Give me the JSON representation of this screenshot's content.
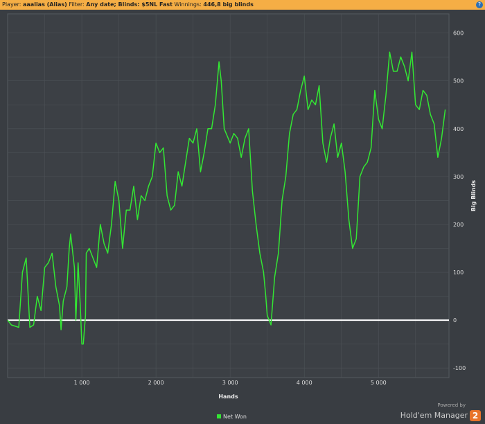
{
  "header": {
    "player_label": "Player:",
    "player": "aaalias (Alias)",
    "filter_label": "Filter:",
    "filter": "Any date; Blinds: $5NL Fast",
    "winnings_label": "Winnings:",
    "winnings": "446,8 big blinds",
    "help": "?"
  },
  "logo": {
    "powered": "Powered by",
    "name": "Hold'em Manager",
    "badge": "2"
  },
  "chart_data": {
    "type": "line",
    "title": "",
    "xlabel": "Hands",
    "ylabel": "Big Blinds",
    "xlim": [
      0,
      5950
    ],
    "ylim": [
      -120,
      640
    ],
    "xticks": [
      1000,
      2000,
      3000,
      4000,
      5000
    ],
    "xtick_labels": [
      "1 000",
      "2 000",
      "3 000",
      "4 000",
      "5 000"
    ],
    "yticks": [
      -100,
      0,
      100,
      200,
      300,
      400,
      500,
      600
    ],
    "ytick_labels": [
      "-100",
      "0",
      "100",
      "200",
      "300",
      "400",
      "500",
      "600"
    ],
    "grid": true,
    "legend": "bottom-center",
    "line_color": "#33e633",
    "series": [
      {
        "name": "Net Won",
        "x": [
          0,
          50,
          150,
          200,
          250,
          300,
          350,
          400,
          450,
          500,
          550,
          600,
          650,
          700,
          720,
          750,
          800,
          830,
          850,
          900,
          920,
          950,
          980,
          1000,
          1020,
          1050,
          1060,
          1100,
          1200,
          1250,
          1300,
          1350,
          1400,
          1450,
          1500,
          1550,
          1600,
          1650,
          1700,
          1750,
          1800,
          1850,
          1900,
          1950,
          2000,
          2050,
          2100,
          2150,
          2200,
          2250,
          2300,
          2350,
          2400,
          2450,
          2500,
          2550,
          2600,
          2650,
          2700,
          2750,
          2800,
          2850,
          2880,
          2920,
          3000,
          3050,
          3100,
          3150,
          3200,
          3250,
          3280,
          3300,
          3350,
          3400,
          3450,
          3480,
          3500,
          3550,
          3600,
          3650,
          3700,
          3750,
          3800,
          3850,
          3900,
          3950,
          4000,
          4050,
          4100,
          4150,
          4200,
          4250,
          4300,
          4350,
          4400,
          4450,
          4500,
          4550,
          4600,
          4650,
          4700,
          4750,
          4800,
          4850,
          4900,
          4950,
          5000,
          5050,
          5100,
          5150,
          5200,
          5250,
          5300,
          5350,
          5400,
          5450,
          5500,
          5550,
          5600,
          5650,
          5700,
          5750,
          5800,
          5850,
          5900
        ],
        "y": [
          0,
          -10,
          -15,
          100,
          130,
          -15,
          -10,
          50,
          20,
          110,
          120,
          140,
          70,
          30,
          -20,
          40,
          70,
          150,
          180,
          110,
          0,
          120,
          30,
          -50,
          -50,
          10,
          140,
          150,
          110,
          200,
          160,
          140,
          200,
          290,
          250,
          150,
          230,
          230,
          280,
          210,
          260,
          250,
          280,
          300,
          370,
          350,
          360,
          260,
          230,
          240,
          310,
          280,
          330,
          380,
          370,
          400,
          310,
          350,
          400,
          400,
          450,
          540,
          500,
          400,
          370,
          390,
          380,
          340,
          380,
          400,
          320,
          270,
          200,
          140,
          100,
          50,
          10,
          -10,
          90,
          140,
          250,
          300,
          390,
          430,
          440,
          480,
          510,
          440,
          460,
          450,
          490,
          370,
          330,
          380,
          410,
          340,
          370,
          310,
          210,
          150,
          170,
          300,
          320,
          330,
          360,
          480,
          420,
          400,
          470,
          560,
          520,
          520,
          550,
          530,
          500,
          560,
          450,
          440,
          480,
          470,
          430,
          410,
          340,
          380,
          440
        ]
      }
    ],
    "baseline": 0
  }
}
